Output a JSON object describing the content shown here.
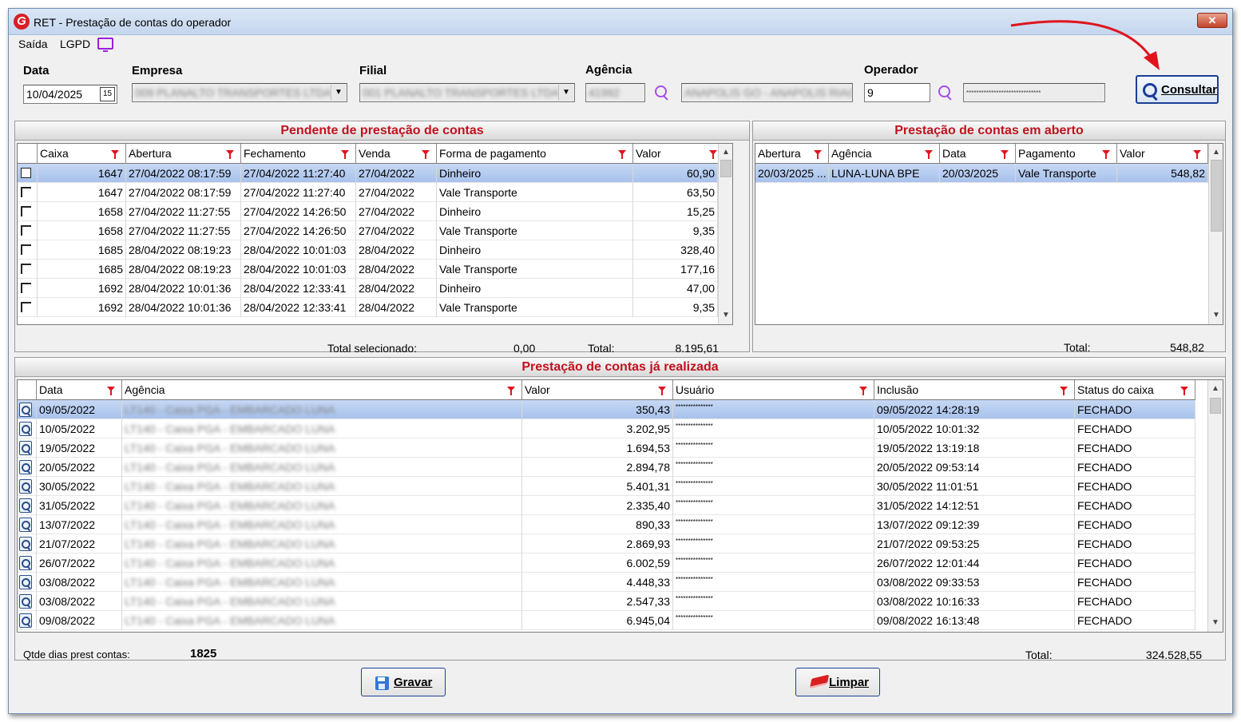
{
  "window": {
    "title": "RET - Prestação de contas do operador",
    "close_label": "✕"
  },
  "menu": {
    "items": [
      "Saída",
      "LGPD"
    ]
  },
  "filters": {
    "data_label": "Data",
    "data_value": "10/04/2025",
    "calendar_glyph": "15",
    "empresa_label": "Empresa",
    "empresa_value": "009 PLANALTO TRANSPORTES LTDA",
    "filial_label": "Filial",
    "filial_value": "001 PLANALTO TRANSPORTES LTDA",
    "agencia_label": "Agência",
    "agencia_code": "41992",
    "agencia_name": "ANAPOLIS GO - ANAPOLIS RIACH",
    "operador_label": "Operador",
    "operador_code": "9",
    "operador_name": "******************************",
    "consultar_label": "Consultar"
  },
  "pendente": {
    "title": "Pendente de prestação de contas",
    "columns": [
      "Caixa",
      "Abertura",
      "Fechamento",
      "Venda",
      "Forma de pagamento",
      "Valor"
    ],
    "rows": [
      [
        "1647",
        "27/04/2022 08:17:59",
        "27/04/2022 11:27:40",
        "27/04/2022",
        "Dinheiro",
        "60,90"
      ],
      [
        "1647",
        "27/04/2022 08:17:59",
        "27/04/2022 11:27:40",
        "27/04/2022",
        "Vale Transporte",
        "63,50"
      ],
      [
        "1658",
        "27/04/2022 11:27:55",
        "27/04/2022 14:26:50",
        "27/04/2022",
        "Dinheiro",
        "15,25"
      ],
      [
        "1658",
        "27/04/2022 11:27:55",
        "27/04/2022 14:26:50",
        "27/04/2022",
        "Vale Transporte",
        "9,35"
      ],
      [
        "1685",
        "28/04/2022 08:19:23",
        "28/04/2022 10:01:03",
        "28/04/2022",
        "Dinheiro",
        "328,40"
      ],
      [
        "1685",
        "28/04/2022 08:19:23",
        "28/04/2022 10:01:03",
        "28/04/2022",
        "Vale Transporte",
        "177,16"
      ],
      [
        "1692",
        "28/04/2022 10:01:36",
        "28/04/2022 12:33:41",
        "28/04/2022",
        "Dinheiro",
        "47,00"
      ],
      [
        "1692",
        "28/04/2022 10:01:36",
        "28/04/2022 12:33:41",
        "28/04/2022",
        "Vale Transporte",
        "9,35"
      ]
    ],
    "total_selecionado_label": "Total selecionado:",
    "total_selecionado_value": "0,00",
    "total_label": "Total:",
    "total_value": "8.195,61"
  },
  "aberto": {
    "title": "Prestação de contas em aberto",
    "columns": [
      "Abertura",
      "Agência",
      "Data",
      "Pagamento",
      "Valor"
    ],
    "rows": [
      [
        "20/03/2025 ...",
        "LUNA-LUNA BPE",
        "20/03/2025",
        "Vale Transporte",
        "548,82"
      ]
    ],
    "total_label": "Total:",
    "total_value": "548,82"
  },
  "realizada": {
    "title": "Prestação de contas já realizada",
    "columns": [
      "Data",
      "Agência",
      "Valor",
      "Usuário",
      "Inclusão",
      "Status do caixa"
    ],
    "agencia_mask": "LT140 - Caixa PGA - EMBARCADO LUNA",
    "rows": [
      [
        "09/05/2022",
        "350,43",
        "***************",
        "09/05/2022 14:28:19",
        "FECHADO"
      ],
      [
        "10/05/2022",
        "3.202,95",
        "***************",
        "10/05/2022 10:01:32",
        "FECHADO"
      ],
      [
        "19/05/2022",
        "1.694,53",
        "***************",
        "19/05/2022 13:19:18",
        "FECHADO"
      ],
      [
        "20/05/2022",
        "2.894,78",
        "***************",
        "20/05/2022 09:53:14",
        "FECHADO"
      ],
      [
        "30/05/2022",
        "5.401,31",
        "***************",
        "30/05/2022 11:01:51",
        "FECHADO"
      ],
      [
        "31/05/2022",
        "2.335,40",
        "***************",
        "31/05/2022 14:12:51",
        "FECHADO"
      ],
      [
        "13/07/2022",
        "890,33",
        "***************",
        "13/07/2022 09:12:39",
        "FECHADO"
      ],
      [
        "21/07/2022",
        "2.869,93",
        "***************",
        "21/07/2022 09:53:25",
        "FECHADO"
      ],
      [
        "26/07/2022",
        "6.002,59",
        "***************",
        "26/07/2022 12:01:44",
        "FECHADO"
      ],
      [
        "03/08/2022",
        "4.448,33",
        "***************",
        "03/08/2022 09:33:53",
        "FECHADO"
      ],
      [
        "03/08/2022",
        "2.547,33",
        "***************",
        "03/08/2022 10:16:33",
        "FECHADO"
      ],
      [
        "09/08/2022",
        "6.945,04",
        "***************",
        "09/08/2022 16:13:48",
        "FECHADO"
      ]
    ],
    "qtde_label": "Qtde dias prest contas:",
    "qtde_value": "1825",
    "total_label": "Total:",
    "total_value": "324.528,55"
  },
  "actions": {
    "gravar_label": "Gravar",
    "limpar_label": "Limpar"
  },
  "colors": {
    "accent": "#1c3f94",
    "header_red": "#c1121f",
    "selection": "#a8c2ec",
    "annotation_arrow": "#e0141e"
  }
}
